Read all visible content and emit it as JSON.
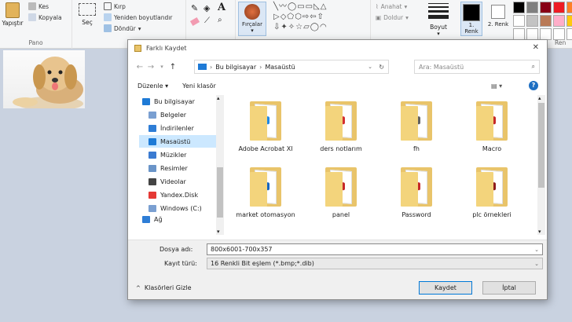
{
  "ribbon": {
    "paste_label": "Yapıştır",
    "cut_label": "Kes",
    "copy_label": "Kopyala",
    "clipboard_group": "Pano",
    "select_label": "Seç",
    "crop_label": "Kırp",
    "resize_label": "Yeniden boyutlandır",
    "rotate_label": "Döndür",
    "image_group_partial": "Re",
    "brushes_label": "Fırçalar",
    "outline_label": "Anahat",
    "fill_label": "Doldur",
    "size_label": "Boyut",
    "color1_label": "1. Renk",
    "color2_label": "2. Renk",
    "colors_group_partial": "Ren",
    "palette": [
      "#000000",
      "#7f7f7f",
      "#880015",
      "#ed1c24",
      "#ff7f27",
      "#ffffff",
      "#c3c3c3",
      "#b97a57",
      "#ffaec9",
      "#ffc90e",
      "#ffffff",
      "#ffffff",
      "#ffffff",
      "#ffffff",
      "#ffffff"
    ]
  },
  "dialog": {
    "title": "Farklı Kaydet",
    "breadcrumb": [
      "Bu bilgisayar",
      "Masaüstü"
    ],
    "search_placeholder": "Ara: Masaüstü",
    "organize_label": "Düzenle",
    "new_folder_label": "Yeni klasör",
    "nav_items": [
      {
        "label": "Bu bilgisayar",
        "icon": "computer-icon"
      },
      {
        "label": "Belgeler",
        "icon": "documents-icon"
      },
      {
        "label": "İndirilenler",
        "icon": "downloads-icon"
      },
      {
        "label": "Masaüstü",
        "icon": "desktop-icon"
      },
      {
        "label": "Müzikler",
        "icon": "music-icon"
      },
      {
        "label": "Resimler",
        "icon": "pictures-icon"
      },
      {
        "label": "Videolar",
        "icon": "videos-icon"
      },
      {
        "label": "Yandex.Disk",
        "icon": "yandex-disk-icon"
      },
      {
        "label": "Windows (C:)",
        "icon": "drive-icon"
      },
      {
        "label": "Ağ",
        "icon": "network-icon"
      }
    ],
    "files": [
      {
        "name": "Adobe Acrobat XI",
        "accent": "#1e88e5"
      },
      {
        "name": "ders notlarım",
        "accent": "#d32f2f"
      },
      {
        "name": "fh",
        "accent": "#616161"
      },
      {
        "name": "Macro",
        "accent": "#c62828"
      },
      {
        "name": "market otomasyon",
        "accent": "#1565c0"
      },
      {
        "name": "panel",
        "accent": "#c62828"
      },
      {
        "name": "Password",
        "accent": "#c62828"
      },
      {
        "name": "plc örnekleri",
        "accent": "#8e1b1b"
      }
    ],
    "filename_label": "Dosya adı:",
    "filename_value": "800x6001-700x357",
    "filetype_label": "Kayıt türü:",
    "filetype_value": "16 Renkli Bit eşlem (*.bmp;*.dib)",
    "hide_folders_label": "Klasörleri Gizle",
    "save_label": "Kaydet",
    "cancel_label": "İptal"
  }
}
